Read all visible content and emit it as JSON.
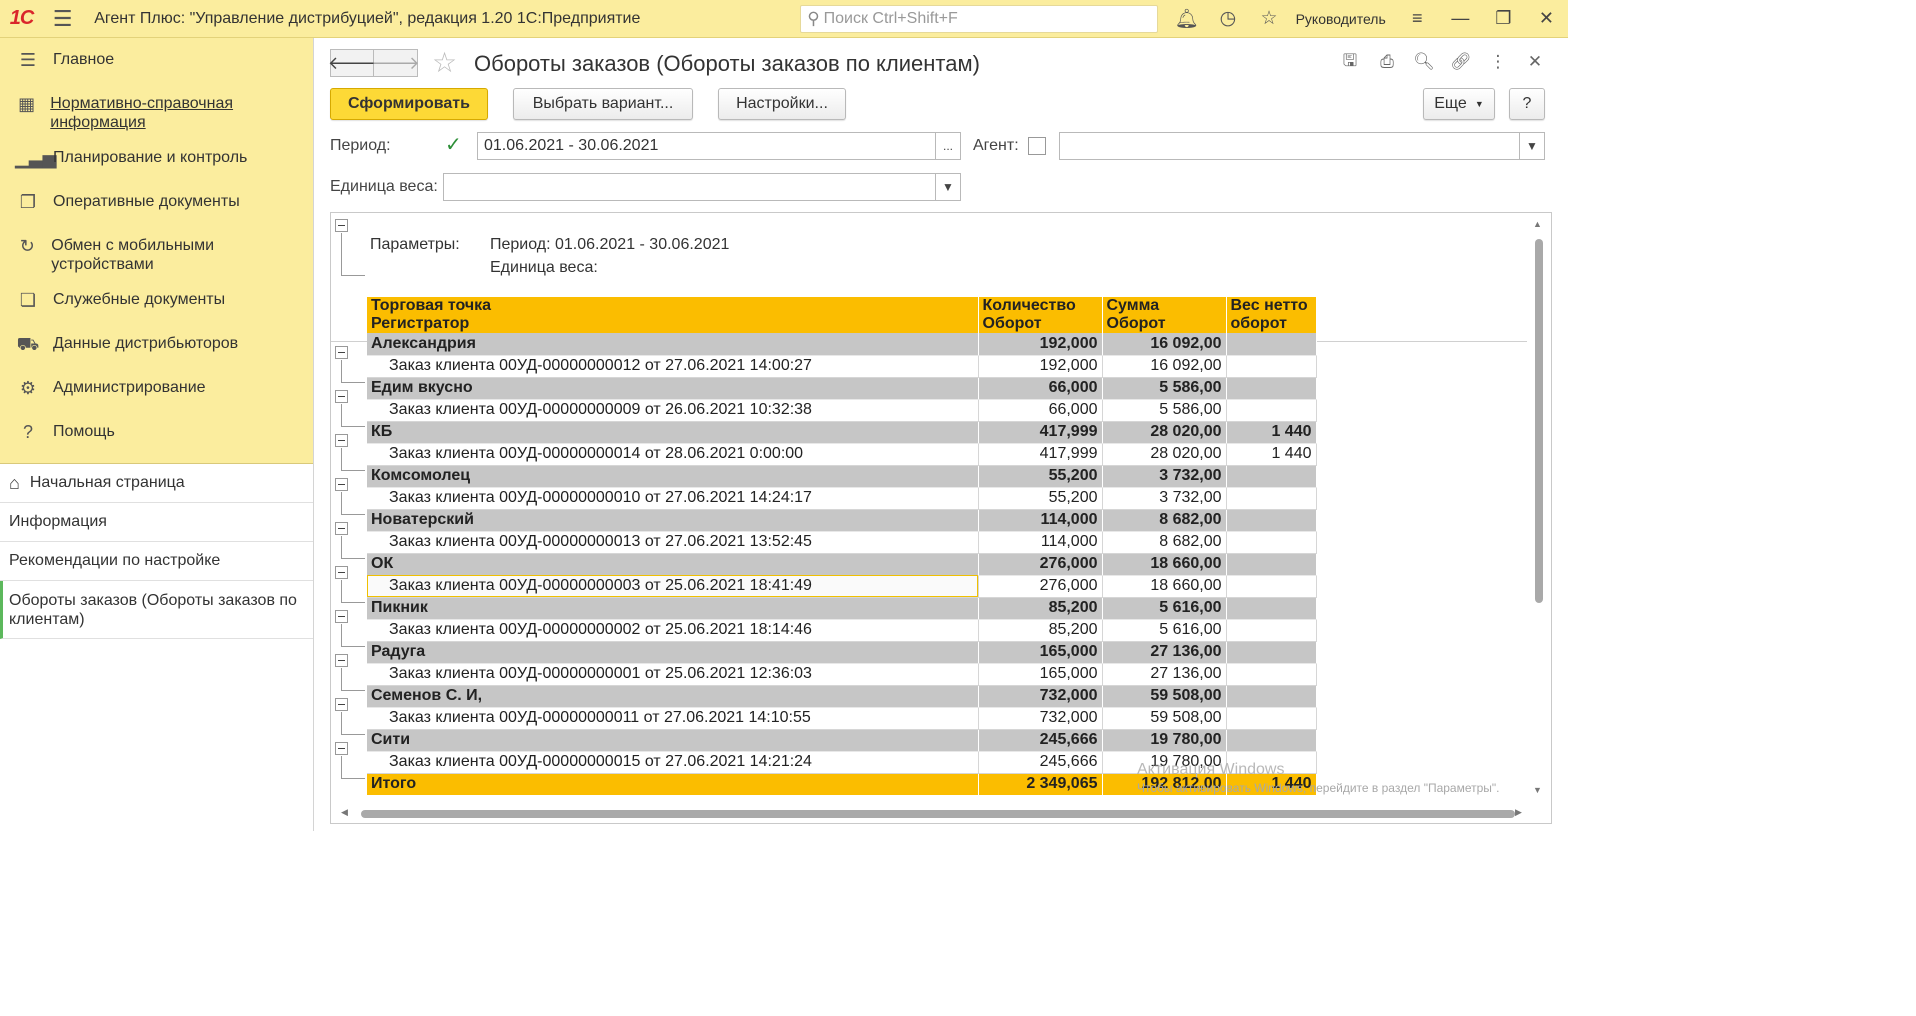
{
  "app": {
    "logo": "1С",
    "title": "Агент Плюс: \"Управление дистрибуцией\", редакция 1.20 1С:Предприятие",
    "search_placeholder": "Поиск Ctrl+Shift+F",
    "user": "Руководитель"
  },
  "sidebar": {
    "sections": [
      {
        "label": "Главное",
        "icon": "menu-icon"
      },
      {
        "label": "Нормативно-справочная информация",
        "icon": "catalog-icon"
      },
      {
        "label": "Планирование и контроль",
        "icon": "chart-icon"
      },
      {
        "label": "Оперативные документы",
        "icon": "documents-icon"
      },
      {
        "label": "Обмен с мобильными устройствами",
        "icon": "sync-icon"
      },
      {
        "label": "Служебные документы",
        "icon": "service-docs-icon"
      },
      {
        "label": "Данные дистрибьюторов",
        "icon": "distributor-icon"
      },
      {
        "label": "Администрирование",
        "icon": "gear-icon"
      },
      {
        "label": "Помощь",
        "icon": "help-icon"
      }
    ],
    "open": [
      {
        "label": "Начальная страница"
      },
      {
        "label": "Информация"
      },
      {
        "label": "Рекомендации по настройке"
      },
      {
        "label": "Обороты заказов (Обороты заказов по клиентам)"
      }
    ]
  },
  "form": {
    "title": "Обороты заказов (Обороты заказов по клиентам)",
    "buttons": {
      "generate": "Сформировать",
      "choose_variant": "Выбрать вариант...",
      "settings": "Настройки...",
      "more": "Еще",
      "help": "?"
    },
    "fields": {
      "period_label": "Период:",
      "period_value": "01.06.2021 - 30.06.2021",
      "period_button": "...",
      "agent_label": "Агент:",
      "agent_value": "",
      "weight_label": "Единица веса:",
      "weight_value": ""
    }
  },
  "report": {
    "params_label": "Параметры:",
    "params_period": "Период: 01.06.2021 - 30.06.2021",
    "params_weight": "Единица веса:",
    "headers": {
      "col1_line1": "Торговая точка",
      "col1_line2": "Регистратор",
      "col2_line1": "Количество",
      "col2_line2": "Оборот",
      "col3_line1": "Сумма",
      "col3_line2": "Оборот",
      "col4_line1": "Вес нетто",
      "col4_line2": "оборот"
    },
    "groups": [
      {
        "name": "Александрия",
        "qty": "192,000",
        "sum": "16 092,00",
        "weight": "",
        "doc": "Заказ клиента 00УД-00000000012 от 27.06.2021 14:00:27",
        "doc_qty": "192,000",
        "doc_sum": "16 092,00",
        "doc_weight": ""
      },
      {
        "name": "Едим вкусно",
        "qty": "66,000",
        "sum": "5 586,00",
        "weight": "",
        "doc": "Заказ клиента 00УД-00000000009 от 26.06.2021 10:32:38",
        "doc_qty": "66,000",
        "doc_sum": "5 586,00",
        "doc_weight": ""
      },
      {
        "name": "КБ",
        "qty": "417,999",
        "sum": "28 020,00",
        "weight": "1 440",
        "doc": "Заказ клиента 00УД-00000000014 от 28.06.2021 0:00:00",
        "doc_qty": "417,999",
        "doc_sum": "28 020,00",
        "doc_weight": "1 440"
      },
      {
        "name": "Комсомолец",
        "qty": "55,200",
        "sum": "3 732,00",
        "weight": "",
        "doc": "Заказ клиента 00УД-00000000010 от 27.06.2021 14:24:17",
        "doc_qty": "55,200",
        "doc_sum": "3 732,00",
        "doc_weight": ""
      },
      {
        "name": "Новатерский",
        "qty": "114,000",
        "sum": "8 682,00",
        "weight": "",
        "doc": "Заказ клиента 00УД-00000000013 от 27.06.2021 13:52:45",
        "doc_qty": "114,000",
        "doc_sum": "8 682,00",
        "doc_weight": ""
      },
      {
        "name": "ОК",
        "qty": "276,000",
        "sum": "18 660,00",
        "weight": "",
        "doc": "Заказ клиента 00УД-00000000003 от 25.06.2021 18:41:49",
        "doc_qty": "276,000",
        "doc_sum": "18 660,00",
        "doc_weight": ""
      },
      {
        "name": "Пикник",
        "qty": "85,200",
        "sum": "5 616,00",
        "weight": "",
        "doc": "Заказ клиента 00УД-00000000002 от 25.06.2021 18:14:46",
        "doc_qty": "85,200",
        "doc_sum": "5 616,00",
        "doc_weight": ""
      },
      {
        "name": "Радуга",
        "qty": "165,000",
        "sum": "27 136,00",
        "weight": "",
        "doc": "Заказ клиента 00УД-00000000001 от 25.06.2021 12:36:03",
        "doc_qty": "165,000",
        "doc_sum": "27 136,00",
        "doc_weight": ""
      },
      {
        "name": "Семенов С. И,",
        "qty": "732,000",
        "sum": "59 508,00",
        "weight": "",
        "doc": "Заказ клиента 00УД-00000000011 от 27.06.2021 14:10:55",
        "doc_qty": "732,000",
        "doc_sum": "59 508,00",
        "doc_weight": ""
      },
      {
        "name": "Сити",
        "qty": "245,666",
        "sum": "19 780,00",
        "weight": "",
        "doc": "Заказ клиента 00УД-00000000015 от 27.06.2021 14:21:24",
        "doc_qty": "245,666",
        "doc_sum": "19 780,00",
        "doc_weight": ""
      }
    ],
    "total": {
      "label": "Итого",
      "qty": "2 349,065",
      "sum": "192 812,00",
      "weight": "1 440"
    },
    "selected_doc_index": 5
  },
  "watermark": {
    "line1": "Активация Windows",
    "line2": "Чтобы активировать Windows, перейдите в раздел \"Параметры\"."
  },
  "colors": {
    "accent_yellow": "#fbed9e",
    "header_orange": "#fbbd00",
    "group_gray": "#c6c6c6",
    "primary_button": "#fdd936"
  }
}
